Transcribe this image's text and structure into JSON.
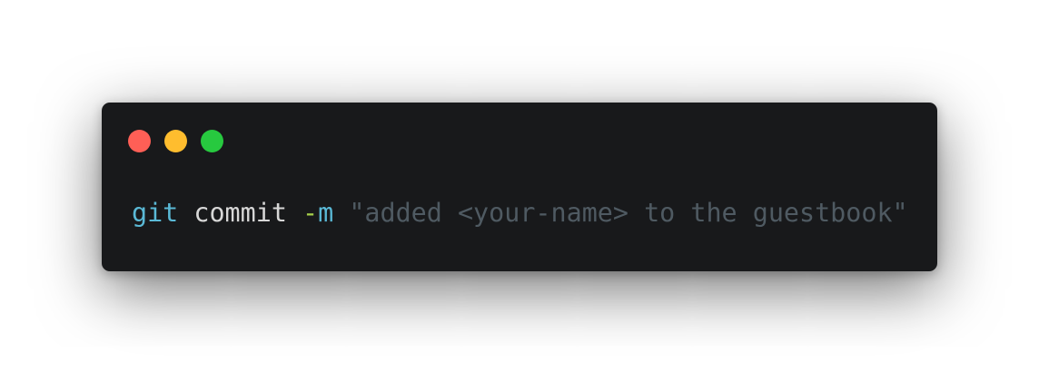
{
  "window": {
    "controls": [
      {
        "name": "close",
        "color": "#ff5f56"
      },
      {
        "name": "minimize",
        "color": "#ffbd2e"
      },
      {
        "name": "zoom",
        "color": "#27c93f"
      }
    ],
    "background": "#18191b"
  },
  "command": {
    "program": "git",
    "subcommand": "commit",
    "flag_dash": "-",
    "flag_letter": "m",
    "message": "\"added <your-name> to the guestbook\""
  },
  "colors": {
    "program": "#5ab9d6",
    "subcommand": "#d7d7d7",
    "flag_dash": "#a6d04a",
    "flag_letter": "#5ab9d6",
    "message": "#4f5a62"
  }
}
